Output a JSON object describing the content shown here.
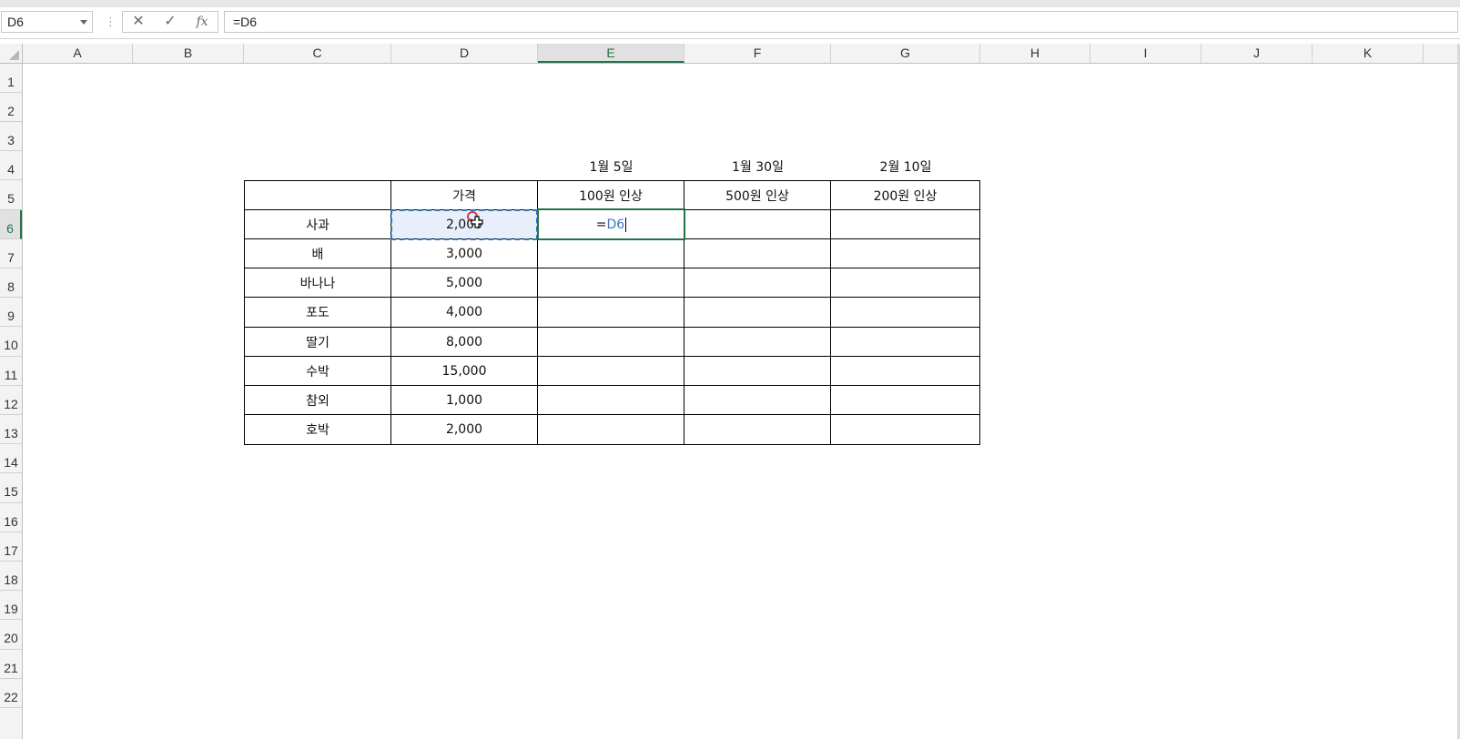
{
  "name_box": "D6",
  "formula": "=D6",
  "icons": {
    "cancel": "✕",
    "enter": "✓",
    "function": "fx",
    "more": "⋮"
  },
  "columns": [
    "A",
    "B",
    "C",
    "D",
    "E",
    "F",
    "G",
    "H",
    "I",
    "J",
    "K"
  ],
  "active_column": "E",
  "rows": [
    "1",
    "2",
    "3",
    "4",
    "5",
    "6",
    "7",
    "8",
    "9",
    "10",
    "11",
    "12",
    "13",
    "14",
    "15",
    "16",
    "17",
    "18",
    "19",
    "20",
    "21",
    "22"
  ],
  "active_row": "6",
  "dates": [
    "1월 5일",
    "1월 30일",
    "2월 10일"
  ],
  "table": {
    "header": [
      "",
      "가격",
      "100원 인상",
      "500원 인상",
      "200원 인상"
    ],
    "rows": [
      [
        "사과",
        "2,000"
      ],
      [
        "배",
        "3,000"
      ],
      [
        "바나나",
        "5,000"
      ],
      [
        "포도",
        "4,000"
      ],
      [
        "딸기",
        "8,000"
      ],
      [
        "수박",
        "15,000"
      ],
      [
        "참외",
        "1,000"
      ],
      [
        "호박",
        "2,000"
      ]
    ]
  },
  "edit_cell": {
    "eq": "=",
    "ref": "D6"
  },
  "colors": {
    "accent": "#217346",
    "ref_marquee": "#2e75b6",
    "ref_fill": "#e8effa"
  }
}
